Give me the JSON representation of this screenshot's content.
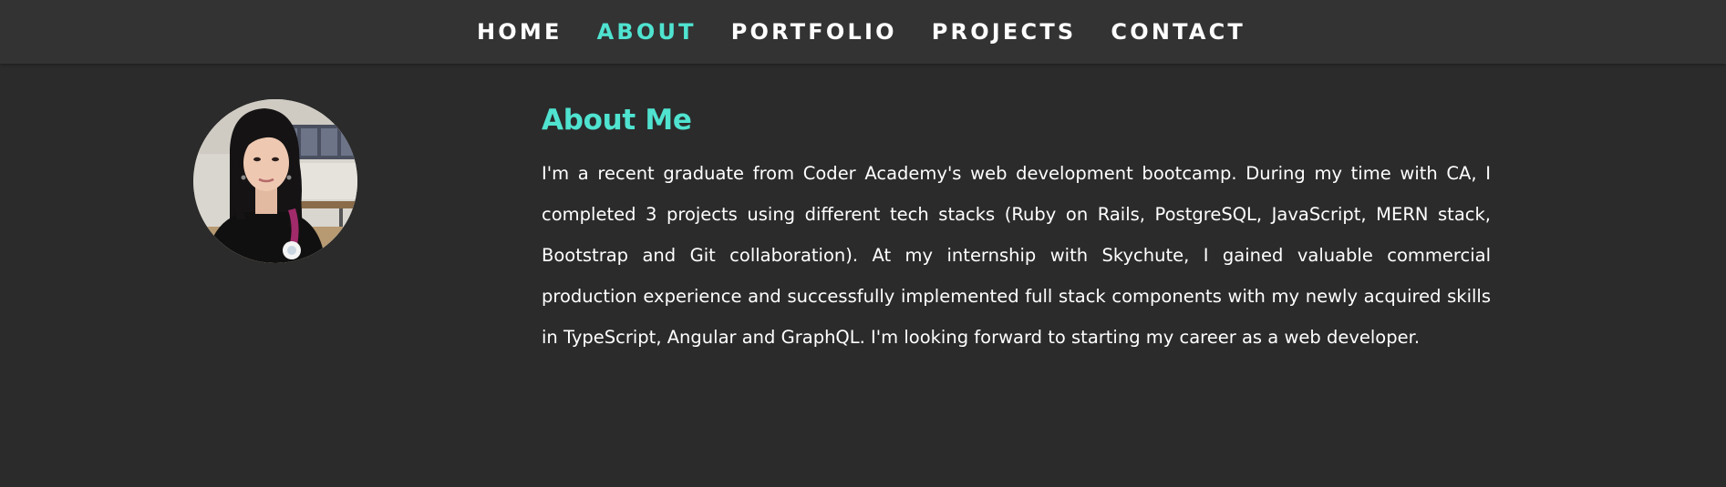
{
  "nav": {
    "items": [
      {
        "label": "HOME",
        "active": false
      },
      {
        "label": "ABOUT",
        "active": true
      },
      {
        "label": "PORTFOLIO",
        "active": false
      },
      {
        "label": "PROJECTS",
        "active": false
      },
      {
        "label": "CONTACT",
        "active": false
      }
    ]
  },
  "about": {
    "title": "About Me",
    "body": "I'm a recent graduate from Coder Academy's web development bootcamp. During my time with CA, I completed 3 projects using different tech stacks (Ruby on Rails, PostgreSQL, JavaScript, MERN stack, Bootstrap and Git collaboration). At my internship with Skychute, I gained valuable commercial production experience and successfully implemented full stack components with my newly acquired skills in TypeScript, Angular and GraphQL. I'm looking forward to starting my career as a web developer."
  },
  "colors": {
    "background": "#2b2b2b",
    "navbar": "#333333",
    "accent": "#4fe3d0",
    "text": "#ffffff"
  }
}
